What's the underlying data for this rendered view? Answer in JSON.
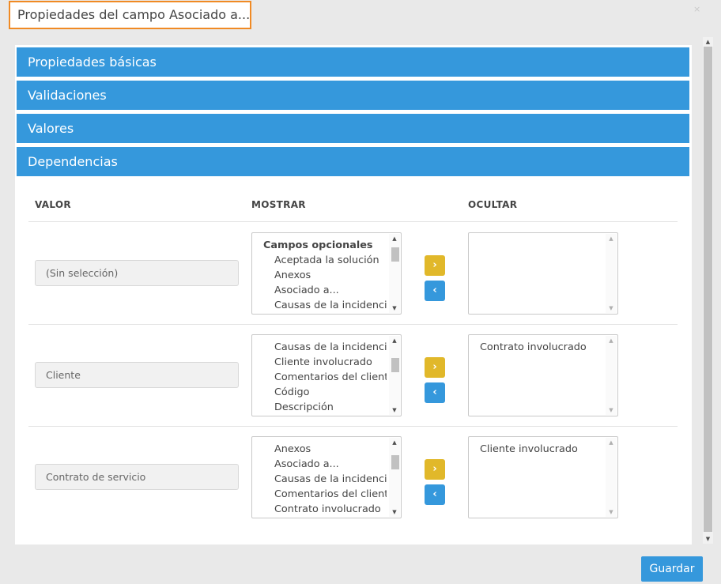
{
  "dialog": {
    "title": "Propiedades del campo Asociado a...",
    "close_glyph": "×",
    "save_label": "Guardar"
  },
  "accordion": [
    {
      "label": "Propiedades básicas"
    },
    {
      "label": "Validaciones"
    },
    {
      "label": "Valores"
    },
    {
      "label": "Dependencias"
    }
  ],
  "columns": {
    "valor": "VALOR",
    "mostrar": "MOSTRAR",
    "ocultar": "OCULTAR"
  },
  "rows": [
    {
      "valor": "(Sin selección)",
      "mostrar": [
        "Campos opcionales",
        "Aceptada la solución",
        "Anexos",
        "Asociado a...",
        "Causas de la incidencia"
      ],
      "ocultar": []
    },
    {
      "valor": "Cliente",
      "mostrar": [
        "Causas de la incidencia",
        "Cliente involucrado",
        "Comentarios del cliente",
        "Código",
        "Descripción"
      ],
      "ocultar": [
        "Contrato involucrado"
      ]
    },
    {
      "valor": "Contrato de servicio",
      "mostrar": [
        "Anexos",
        "Asociado a...",
        "Causas de la incidencia",
        "Comentarios del cliente",
        "Contrato involucrado"
      ],
      "ocultar": [
        "Cliente involucrado"
      ]
    }
  ],
  "buttons": {
    "move_right": "›",
    "move_left": "‹"
  },
  "icons": {
    "scroll_up": "▲",
    "scroll_down": "▼"
  },
  "colors": {
    "accent": "#3598dc",
    "move_right": "#e1b82a",
    "title_border": "#f08a24"
  }
}
